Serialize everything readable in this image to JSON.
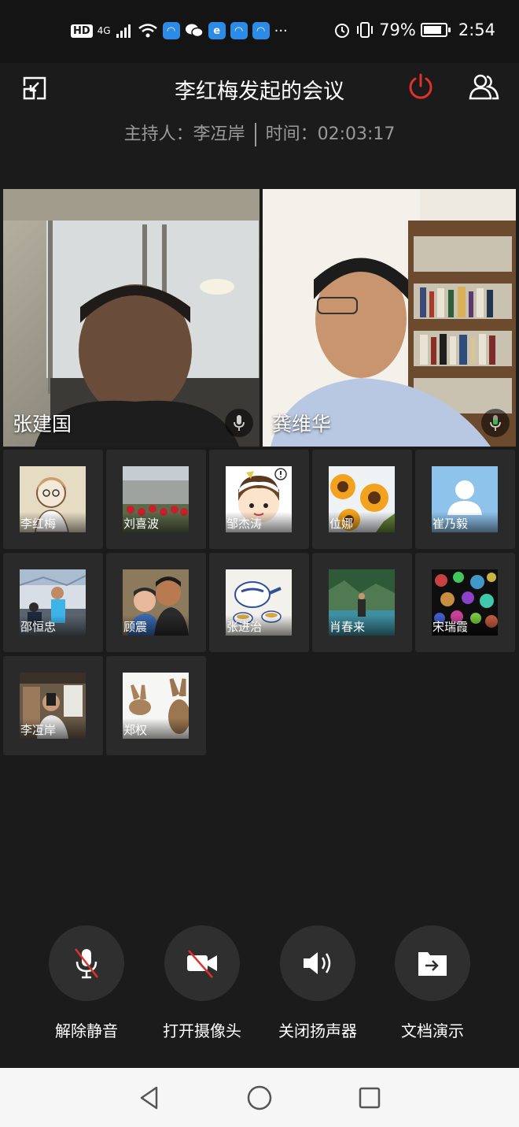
{
  "status_bar": {
    "network": "4G",
    "alarm_icon": "alarm-icon",
    "battery": "79%",
    "time": "2:54",
    "more": "···"
  },
  "header": {
    "title": "李红梅发起的会议",
    "host_text": "主持人：李冱岸",
    "time_text": "时间：02:03:17",
    "leave_color": "#e0322a"
  },
  "videos": [
    {
      "name": "张建国",
      "mic": "muted-gray"
    },
    {
      "name": "龚维华",
      "mic": "active-green"
    }
  ],
  "participants": [
    {
      "name": "李红梅",
      "avatar": "cartoon-girl"
    },
    {
      "name": "刘喜波",
      "avatar": "garden-photo"
    },
    {
      "name": "邹杰涛",
      "avatar": "cartoon-boy"
    },
    {
      "name": "位娜",
      "avatar": "sunflowers"
    },
    {
      "name": "崔乃毅",
      "avatar": "default-person"
    },
    {
      "name": "邵恒忠",
      "avatar": "indoor-photo"
    },
    {
      "name": "顾震",
      "avatar": "family-photo"
    },
    {
      "name": "张进治",
      "avatar": "teapot"
    },
    {
      "name": "肖春来",
      "avatar": "lake-photo"
    },
    {
      "name": "宋瑞霞",
      "avatar": "bokeh-lights"
    },
    {
      "name": "李冱岸",
      "avatar": "selfie-photo"
    },
    {
      "name": "郑权",
      "avatar": "rabbits"
    }
  ],
  "controls": [
    {
      "label": "解除静音",
      "icon": "mic-muted-icon"
    },
    {
      "label": "打开摄像头",
      "icon": "camera-off-icon"
    },
    {
      "label": "关闭扬声器",
      "icon": "speaker-icon"
    },
    {
      "label": "文档演示",
      "icon": "share-doc-icon"
    }
  ]
}
